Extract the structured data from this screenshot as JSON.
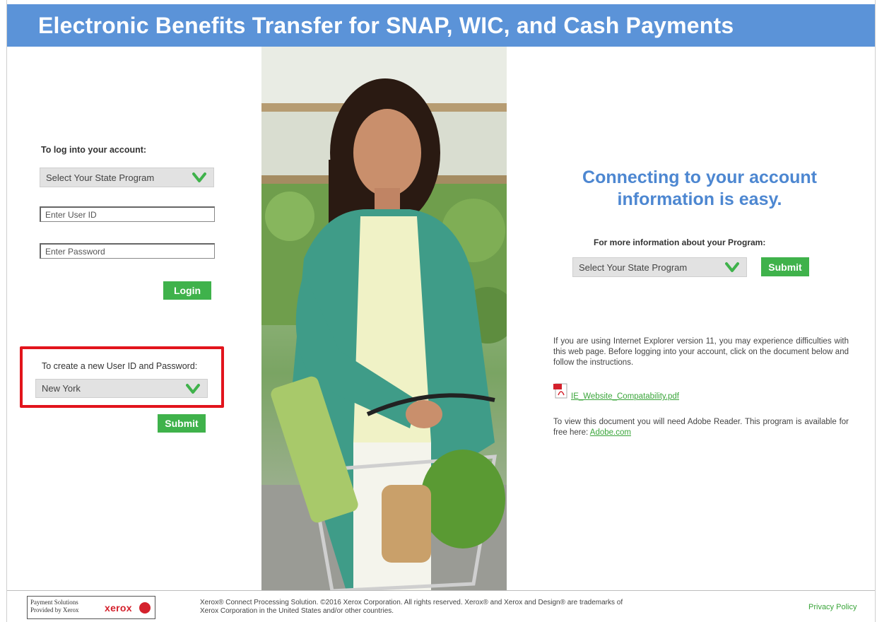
{
  "header": {
    "title": "Electronic Benefits Transfer for SNAP, WIC, and Cash Payments"
  },
  "login": {
    "heading": "To log into your account:",
    "state_select": "Select Your State Program",
    "userid_placeholder": "Enter User ID",
    "password_placeholder": "Enter Password",
    "login_label": "Login"
  },
  "create": {
    "heading": "To create a new User ID and Password:",
    "state_select": "New York",
    "submit_label": "Submit",
    "highlight_color": "#e2141c"
  },
  "info": {
    "tagline_line1": "Connecting to your account",
    "tagline_line2": "information is easy.",
    "program_heading": "For more information about your Program:",
    "state_select": "Select Your State Program",
    "submit_label": "Submit",
    "ie_notice": "If you are using Internet Explorer version 11, you may experience difficulties with this web page. Before logging into your account, click on the document below and follow the instructions.",
    "pdf_link": "IE_Website_Compatability.pdf",
    "adobe_text": "To view this document you will need Adobe Reader. This program is available for free here:",
    "adobe_link": "Adobe.com"
  },
  "footer": {
    "badge_line1": "Payment Solutions",
    "badge_line2": "Provided by Xerox",
    "badge_brand": "xerox",
    "copyright": "Xerox® Connect Processing Solution. ©2016 Xerox Corporation. All rights reserved. Xerox® and Xerox and Design® are trademarks of Xerox Corporation in the United States and/or other countries.",
    "privacy": "Privacy Policy"
  },
  "colors": {
    "header": "#5b93d8",
    "button": "#3fb24b",
    "tagline": "#4d87d1",
    "link": "#3aa53a"
  },
  "icons": [
    "chevron-down-icon",
    "pdf-icon",
    "xerox-logo-icon"
  ]
}
